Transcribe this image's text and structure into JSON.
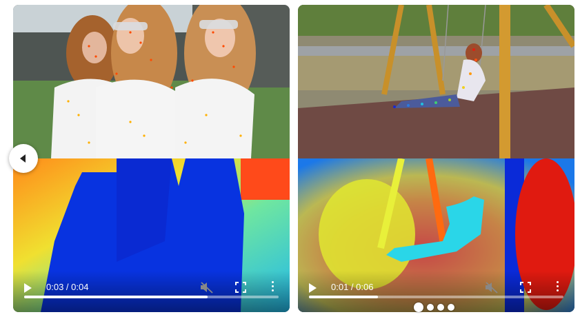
{
  "videos": [
    {
      "time": "0:03 / 0:04",
      "progress": 0.72,
      "scene": "three people in lab coats and goggles with tracked point overlay; depth map below"
    },
    {
      "time": "0:01 / 0:06",
      "progress": 0.27,
      "scene": "person on playground swing with tracked point overlay; depth map below"
    }
  ],
  "carousel": {
    "slide_count": 4,
    "active_index": 0
  },
  "icons": {
    "prev": "chevron-left-icon",
    "play": "play-icon",
    "mute": "volume-muted-icon",
    "fullscreen": "fullscreen-icon",
    "more": "more-vertical-icon"
  }
}
